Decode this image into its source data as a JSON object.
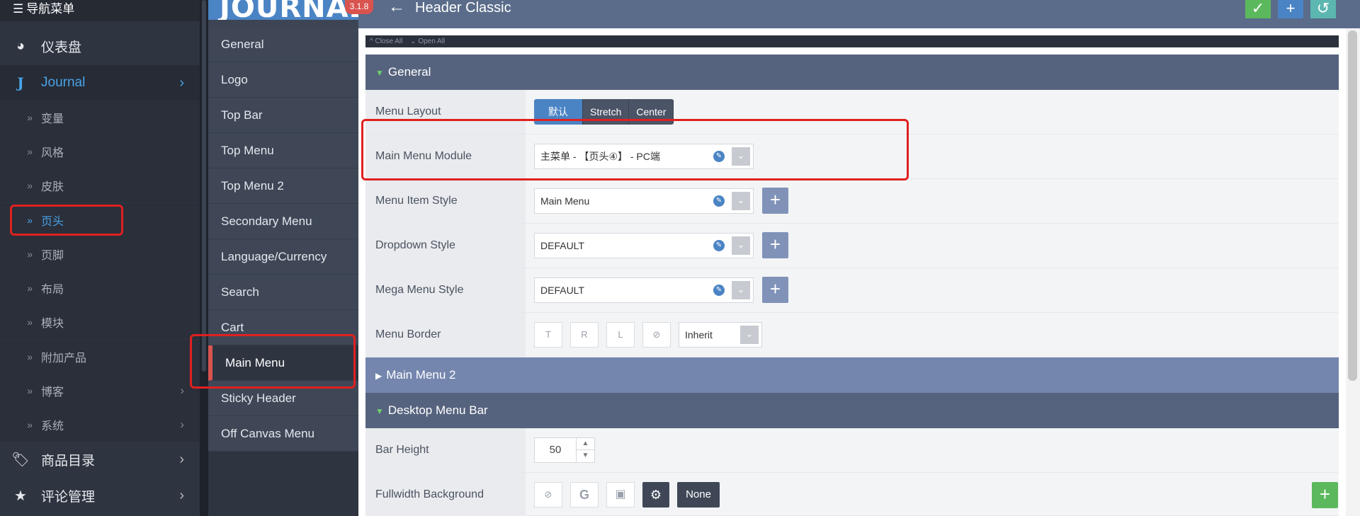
{
  "nav": {
    "header": "导航菜单",
    "top_items": [
      {
        "label": "仪表盘",
        "icon": "dashboard-icon"
      },
      {
        "label": "Journal",
        "icon": "journal-j-icon"
      }
    ],
    "sub_items": [
      "变量",
      "风格",
      "皮肤",
      "页头",
      "页脚",
      "布局",
      "模块",
      "附加产品",
      "博客",
      "系统"
    ],
    "active_sub": "页头",
    "bottom_items": [
      {
        "label": "商品目录",
        "icon": "tag-icon"
      },
      {
        "label": "评论管理",
        "icon": "star-icon"
      }
    ]
  },
  "logo": {
    "text": "JOURNAL",
    "version": "3.1.8"
  },
  "submenu": {
    "items": [
      "General",
      "Logo",
      "Top Bar",
      "Top Menu",
      "Top Menu 2",
      "Secondary Menu",
      "Language/Currency",
      "Search",
      "Cart",
      "Main Menu",
      "Sticky Header",
      "Off Canvas Menu"
    ],
    "active": "Main Menu"
  },
  "header": {
    "title": "Header Classic"
  },
  "toolbar": {
    "close_all": "^ Close All",
    "open_all": "⌄ Open All"
  },
  "sections": {
    "general": "General",
    "main_menu_2": "Main Menu 2",
    "desktop_menu_bar": "Desktop Menu Bar"
  },
  "fields": {
    "menu_layout": {
      "label": "Menu Layout",
      "options": [
        "默认",
        "Stretch",
        "Center"
      ],
      "selected": "默认"
    },
    "main_menu_module": {
      "label": "Main Menu Module",
      "value": "主菜单 - 【页头④】 - PC端"
    },
    "menu_item_style": {
      "label": "Menu Item Style",
      "value": "Main Menu"
    },
    "dropdown_style": {
      "label": "Dropdown Style",
      "value": "DEFAULT"
    },
    "mega_menu_style": {
      "label": "Mega Menu Style",
      "value": "DEFAULT"
    },
    "menu_border": {
      "label": "Menu Border",
      "sides": [
        "T",
        "R",
        "L"
      ],
      "value": "Inherit"
    },
    "bar_height": {
      "label": "Bar Height",
      "value": "50"
    },
    "fullwidth_background": {
      "label": "Fullwidth Background",
      "value": "None",
      "google_letter": "G"
    }
  },
  "colors": {
    "accent": "#4a84c4",
    "danger": "#d9534f",
    "success": "#5cb85c",
    "section": "#56637e",
    "section_light": "#7486ae"
  }
}
